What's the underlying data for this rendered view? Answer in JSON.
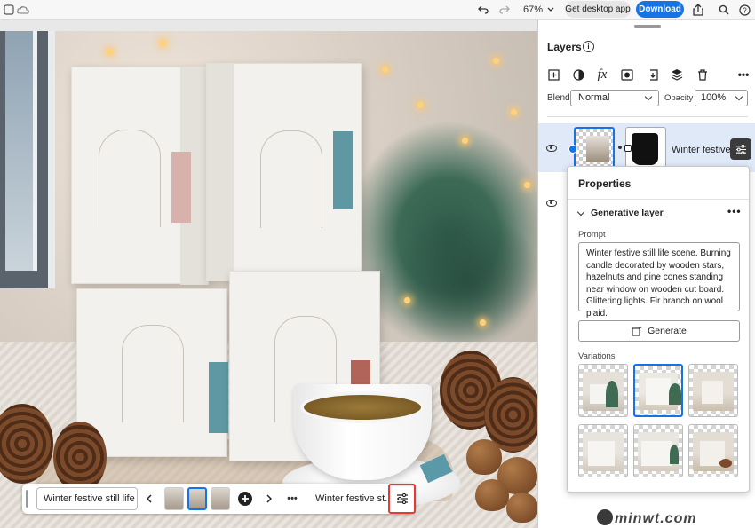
{
  "topbar": {
    "zoom": "67%",
    "desktop_app_label": "Get desktop app",
    "download_label": "Download",
    "icons": [
      "app-logo-icon",
      "cloud-icon",
      "undo-icon",
      "redo-icon",
      "zoom-dropdown-icon",
      "share-icon",
      "search-icon",
      "help-icon"
    ]
  },
  "context_bar": {
    "prompt_field": "Winter festive still life ...",
    "layer_label": "Winter festive st...",
    "more": "•••"
  },
  "layers_panel": {
    "title": "Layers",
    "blend_label": "Blend",
    "blend_value": "Normal",
    "opacity_label": "Opacity",
    "opacity_value": "100%",
    "more": "•••",
    "layer_name": "Winter festive ...",
    "tools": [
      "add-layer-icon",
      "adjustment-icon",
      "fx-icon",
      "mask-icon",
      "import-icon",
      "stack-icon",
      "delete-icon"
    ]
  },
  "properties": {
    "title": "Properties",
    "section": "Generative layer",
    "more": "•••",
    "prompt_label": "Prompt",
    "prompt_text": "Winter festive still life scene. Burning candle decorated by wooden stars, hazelnuts and pine cones standing near window on wooden cut board. Glittering lights. Fir branch on wool plaid.",
    "generate_label": "Generate",
    "variations_label": "Variations",
    "selected_variation": 2
  },
  "watermark": {
    "text": "minwt.com"
  }
}
